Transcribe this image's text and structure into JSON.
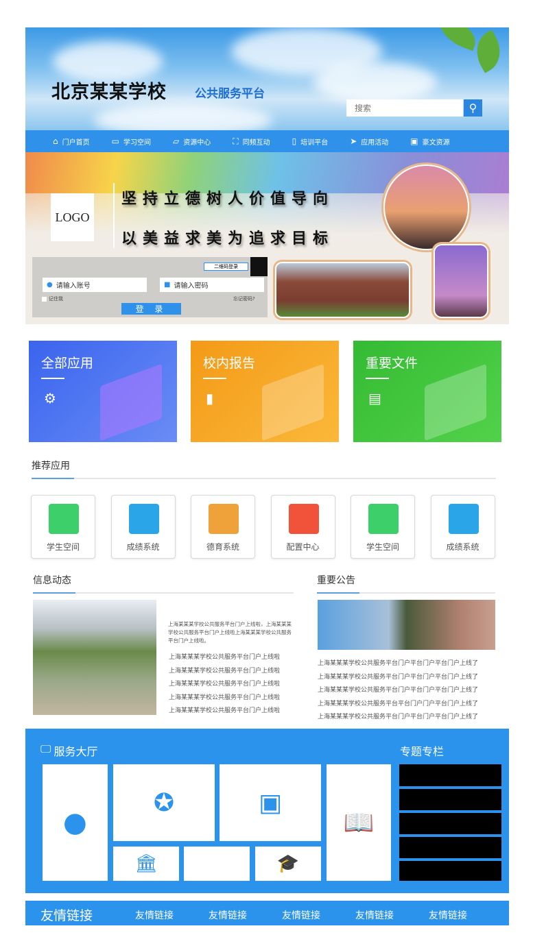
{
  "header": {
    "title": "北京某某学校",
    "subtitle": "公共服务平台",
    "search_placeholder": "搜索",
    "search_icon": "magnifier"
  },
  "nav": [
    {
      "label": "门户首页",
      "icon": "home"
    },
    {
      "label": "学习空间",
      "icon": "monitor"
    },
    {
      "label": "资源中心",
      "icon": "folder"
    },
    {
      "label": "同频互动",
      "icon": "frame"
    },
    {
      "label": "培训平台",
      "icon": "video"
    },
    {
      "label": "应用活动",
      "icon": "paper-plane"
    },
    {
      "label": "豪文资源",
      "icon": "screen"
    }
  ],
  "banner": {
    "logo": "LOGO",
    "slogan1": "坚持立德树人价值导向",
    "slogan2": "以美益求美为追求目标"
  },
  "login": {
    "qr_label": "二维码登录",
    "account_placeholder": "请输入账号",
    "password_placeholder": "请输入密码",
    "remember": "记住我",
    "forgot": "忘记密码?",
    "submit": "登 录"
  },
  "cards": [
    {
      "title": "全部应用",
      "icon": "gear",
      "color": "#3f6ff0"
    },
    {
      "title": "校内报告",
      "icon": "bookmark",
      "color": "#f6a21a"
    },
    {
      "title": "重要文件",
      "icon": "document",
      "color": "#3cc13a"
    }
  ],
  "recommended": {
    "title": "推荐应用",
    "apps": [
      {
        "label": "学生空间",
        "color": "#3ccf6a"
      },
      {
        "label": "成绩系统",
        "color": "#2aa6e8"
      },
      {
        "label": "德育系统",
        "color": "#f0a23a"
      },
      {
        "label": "配置中心",
        "color": "#f0533a"
      },
      {
        "label": "学生空间",
        "color": "#3ccf6a"
      },
      {
        "label": "成绩系统",
        "color": "#2aa6e8"
      }
    ]
  },
  "news": {
    "title": "信息动态",
    "summary": "上海某某某学校公共服务平台门户上线啦，上海某某某学校公共服务平台门户上线啦上海某某某学校公共服务平台门户上线啦。",
    "items": [
      "上海某某某学校公共服务平台门户上线啦",
      "上海某某某学校公共服务平台门户上线啦",
      "上海某某某学校公共服务平台门户上线啦",
      "上海某某某学校公共服务平台门户上线啦",
      "上海某某某学校公共服务平台门户上线啦"
    ]
  },
  "notice": {
    "title": "重要公告",
    "items": [
      "上海某某某学校公共服务平台门户平台门户平台门户上线了",
      "上海某某某学校公共服务平台门户平台门户平台门户上线了",
      "上海某某某学校公共服务平台门户平台门户平台门户上线了",
      "上海某某某学校公共服务平台平台门户门户平台门户上线了",
      "上海某某某学校公共服务平台门户平台门户平台门户上线了"
    ]
  },
  "service": {
    "title": "服务大厅",
    "topics_title": "专题专栏"
  },
  "footer": {
    "title": "友情链接",
    "links": [
      "友情链接",
      "友情链接",
      "友情链接",
      "友情链接",
      "友情链接"
    ]
  }
}
